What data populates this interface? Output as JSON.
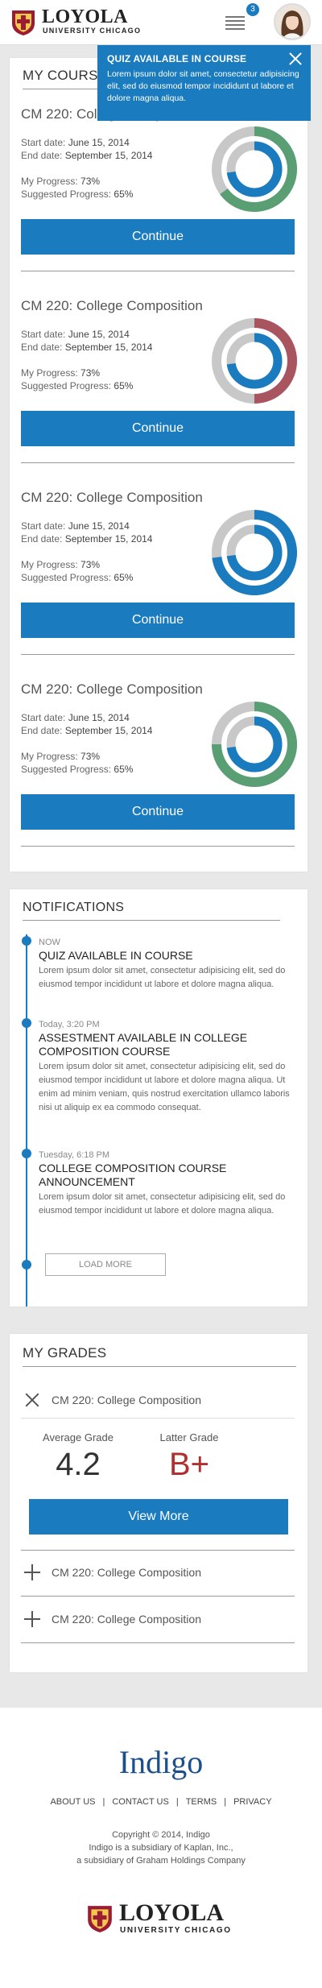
{
  "header": {
    "logo_name": "LOYOLA",
    "logo_sub": "UNIVERSITY CHICAGO",
    "notification_count": "3"
  },
  "popup": {
    "title": "QUIZ AVAILABLE IN COURSE",
    "body": "Lorem ipsum dolor sit amet, consectetur adipisicing elit, sed do eiusmod tempor incididunt ut labore et dolore magna aliqua."
  },
  "my_courses": {
    "title": "MY COURSES",
    "courses": [
      {
        "name": "CM 220: College Composition",
        "start_label": "Start date:",
        "start": "June 15, 2014",
        "end_label": "End date:",
        "end": "September 15, 2014",
        "my_label": "My  Progress:",
        "my_progress": "73%",
        "sugg_label": "Suggested  Progress:",
        "suggested_progress": "65%",
        "outer_color": "#5a9e73",
        "outer_fraction": 0.65,
        "inner_fraction": 0.73,
        "button": "Continue"
      },
      {
        "name": "CM 220: College Composition",
        "start_label": "Start date:",
        "start": "June 15, 2014",
        "end_label": "End date:",
        "end": "September 15, 2014",
        "my_label": "My  Progress:",
        "my_progress": "73%",
        "sugg_label": "Suggested  Progress:",
        "suggested_progress": "65%",
        "outer_color": "#a85560",
        "outer_fraction": 0.5,
        "inner_fraction": 0.73,
        "button": "Continue"
      },
      {
        "name": "CM 220: College Composition",
        "start_label": "Start date:",
        "start": "June 15, 2014",
        "end_label": "End date:",
        "end": "September 15, 2014",
        "my_label": "My  Progress:",
        "my_progress": "73%",
        "sugg_label": "Suggested  Progress:",
        "suggested_progress": "65%",
        "outer_color": "#1a7bbf",
        "outer_fraction": 0.73,
        "inner_fraction": 0.73,
        "button": "Continue"
      },
      {
        "name": "CM 220: College Composition",
        "start_label": "Start date:",
        "start": "June 15, 2014",
        "end_label": "End date:",
        "end": "September 15, 2014",
        "my_label": "My  Progress:",
        "my_progress": "73%",
        "sugg_label": "Suggested  Progress:",
        "suggested_progress": "65%",
        "outer_color": "#5a9e73",
        "outer_fraction": 0.75,
        "inner_fraction": 0.73,
        "button": "Continue"
      }
    ],
    "track_color": "#c8c8c8",
    "inner_color": "#1a7bbf"
  },
  "notifications": {
    "title": "NOTIFICATIONS",
    "items": [
      {
        "time": "NOW",
        "headline": "QUIZ AVAILABLE IN COURSE",
        "body": "Lorem ipsum dolor sit amet, consectetur adipisicing elit, sed do eiusmod tempor incididunt ut labore et dolore magna aliqua."
      },
      {
        "time": "Today, 3:20 PM",
        "headline": "ASSESTMENT AVAILABLE IN COLLEGE COMPOSITION COURSE",
        "body": "Lorem ipsum dolor sit amet, consectetur adipisicing elit, sed do eiusmod tempor incididunt ut labore et dolore magna aliqua. Ut enim ad minim veniam, quis nostrud exercitation ullamco laboris nisi ut aliquip ex ea commodo consequat."
      },
      {
        "time": "Tuesday, 6:18 PM",
        "headline": "COLLEGE COMPOSITION COURSE ANNOUNCEMENT",
        "body": "Lorem ipsum dolor sit amet, consectetur adipisicing elit, sed do eiusmod tempor incididunt ut labore et dolore magna aliqua."
      }
    ],
    "load_more": "LOAD MORE"
  },
  "grades": {
    "title": "MY GRADES",
    "open_course": "CM 220: College Composition",
    "average_label": "Average Grade",
    "average_value": "4.2",
    "latter_label": "Latter Grade",
    "latter_value": "B+",
    "latter_color": "#b03030",
    "view_more": "View More",
    "collapsed_courses": [
      "CM 220: College Composition",
      "CM 220: College Composition"
    ]
  },
  "footer": {
    "brand": "Indigo",
    "links": [
      "ABOUT US",
      "CONTACT US",
      "TERMS",
      "PRIVACY"
    ],
    "copyright": "Copyright © 2014, Indigo",
    "line2": "Indigo is a subsidiary of Kaplan, Inc.,",
    "line3": "a subsidiary of Graham Holdings Company",
    "logo_name": "LOYOLA",
    "logo_sub": "UNIVERSITY CHICAGO"
  }
}
